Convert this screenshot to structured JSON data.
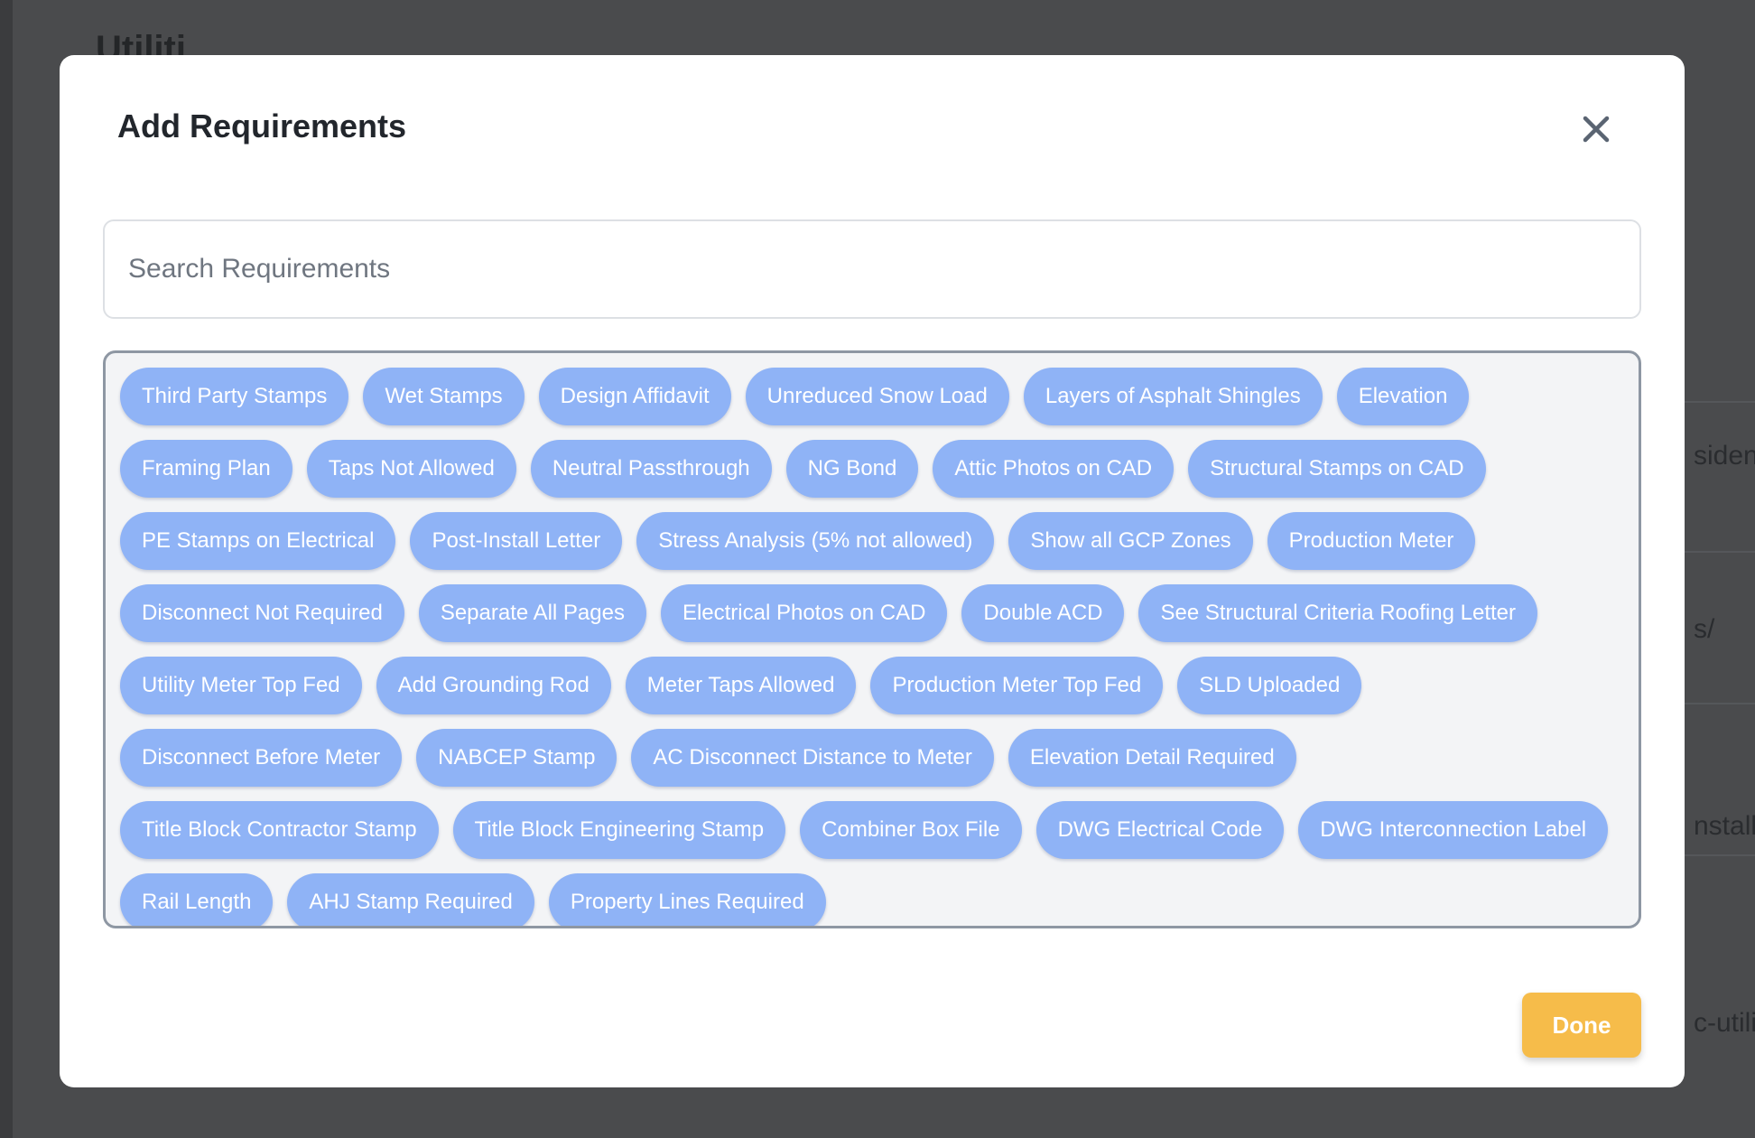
{
  "background": {
    "title": "Utiliti",
    "fragments": [
      "sident",
      "s/",
      "nstalla",
      "c-utilit"
    ]
  },
  "modal": {
    "title": "Add Requirements",
    "close_icon": "close-icon",
    "search": {
      "value": "",
      "placeholder": "Search Requirements"
    },
    "requirements": [
      "Third Party Stamps",
      "Wet Stamps",
      "Design Affidavit",
      "Unreduced Snow Load",
      "Layers of Asphalt Shingles",
      "Elevation",
      "Framing Plan",
      "Taps Not Allowed",
      "Neutral Passthrough",
      "NG Bond",
      "Attic Photos on CAD",
      "Structural Stamps on CAD",
      "PE Stamps on Electrical",
      "Post-Install Letter",
      "Stress Analysis (5% not allowed)",
      "Show all GCP Zones",
      "Production Meter",
      "Disconnect Not Required",
      "Separate All Pages",
      "Electrical Photos on CAD",
      "Double ACD",
      "See Structural Criteria Roofing Letter",
      "Utility Meter Top Fed",
      "Add Grounding Rod",
      "Meter Taps Allowed",
      "Production Meter Top Fed",
      "SLD Uploaded",
      "Disconnect Before Meter",
      "NABCEP Stamp",
      "AC Disconnect Distance to Meter",
      "Elevation Detail Required",
      "Title Block Contractor Stamp",
      "Title Block Engineering Stamp",
      "Combiner Box File",
      "DWG Electrical Code",
      "DWG Interconnection Label",
      "Rail Length",
      "AHJ Stamp Required",
      "Property Lines Required"
    ],
    "done_label": "Done"
  },
  "colors": {
    "chip": "#8fb3f6",
    "done": "#f6bc4a",
    "overlay": "#3b3c3e"
  }
}
